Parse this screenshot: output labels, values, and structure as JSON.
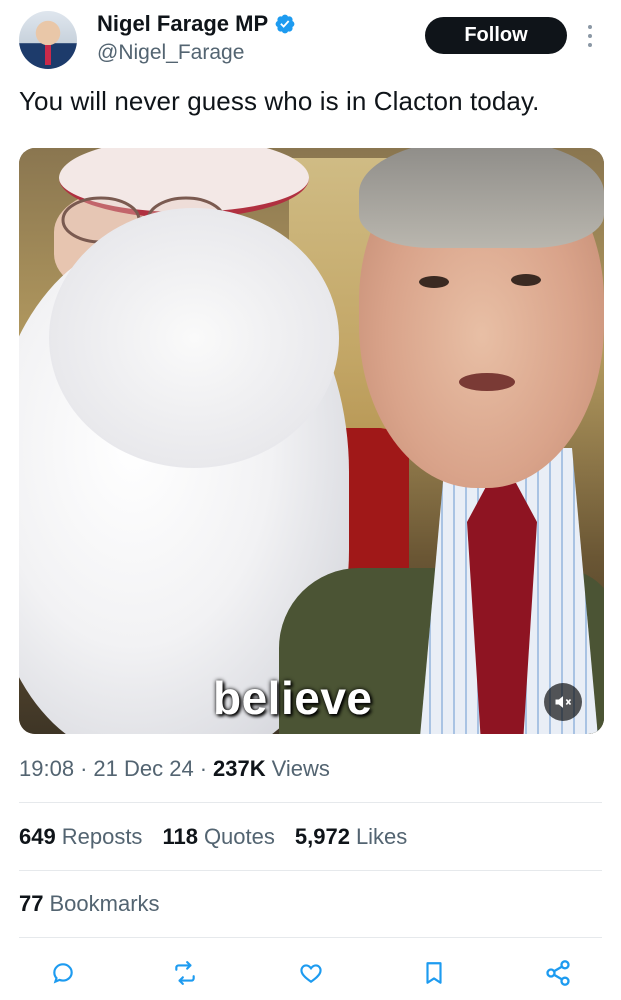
{
  "author": {
    "name": "Nigel Farage MP",
    "handle": "@Nigel_Farage",
    "verified_icon": "verified-badge-icon"
  },
  "header": {
    "follow_label": "Follow",
    "more_icon": "more-vertical-icon"
  },
  "tweet": {
    "text": "You will never guess who is in Clacton today."
  },
  "media": {
    "caption": "believe",
    "mute_icon": "volume-muted-icon"
  },
  "meta": {
    "time": "19:08",
    "sep1": "·",
    "date": "21 Dec 24",
    "sep2": "·",
    "views_count": "237K",
    "views_label": "Views"
  },
  "stats": {
    "reposts_count": "649",
    "reposts_label": "Reposts",
    "quotes_count": "118",
    "quotes_label": "Quotes",
    "likes_count": "5,972",
    "likes_label": "Likes",
    "bookmarks_count": "77",
    "bookmarks_label": "Bookmarks"
  },
  "actions": [
    "reply-icon",
    "repost-icon",
    "like-icon",
    "bookmark-icon",
    "share-icon"
  ],
  "colors": {
    "text": "#0f1419",
    "secondary": "#536471",
    "verified": "#1d9bf0",
    "follow_bg": "#0f1419"
  }
}
